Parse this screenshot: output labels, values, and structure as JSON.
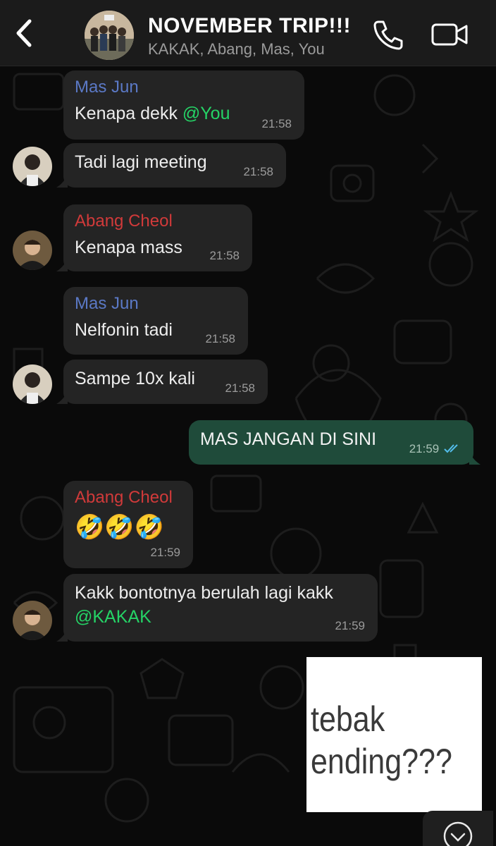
{
  "header": {
    "title": "NOVEMBER TRIP!!!",
    "subtitle": "KAKAK, Abang, Mas, You",
    "back_icon": "chevron-left-icon",
    "call_icon": "phone-icon",
    "video_icon": "video-camera-icon"
  },
  "colors": {
    "name_mas_jun": "#5b79c6",
    "name_abang_cheol": "#d13a3a",
    "mention": "#25d366",
    "outgoing_bubble": "#1f4b3a",
    "incoming_bubble": "#242424",
    "read_ticks": "#53bdeb"
  },
  "messages": [
    {
      "sender": "Mas Jun",
      "text": "Kenapa dekk ",
      "mention": "@You",
      "time": "21:58"
    },
    {
      "text": "Tadi lagi meeting",
      "time": "21:58"
    },
    {
      "sender": "Abang Cheol",
      "text": "Kenapa mass",
      "time": "21:58"
    },
    {
      "sender": "Mas Jun",
      "text": "Nelfonin tadi",
      "time": "21:58"
    },
    {
      "text": "Sampe 10x kali",
      "time": "21:58"
    },
    {
      "text": "MAS JANGAN DI SINI",
      "time": "21:59",
      "status": "read"
    },
    {
      "sender": "Abang Cheol",
      "text": "🤣🤣🤣",
      "time": "21:59"
    },
    {
      "text": "Kakk bontotnya berulah lagi kakk",
      "mention": "@KAKAK",
      "time": "21:59"
    }
  ],
  "sticker": {
    "line1": "tebak",
    "line2": "ending???"
  },
  "scroll_button_icon": "chevron-down-icon"
}
